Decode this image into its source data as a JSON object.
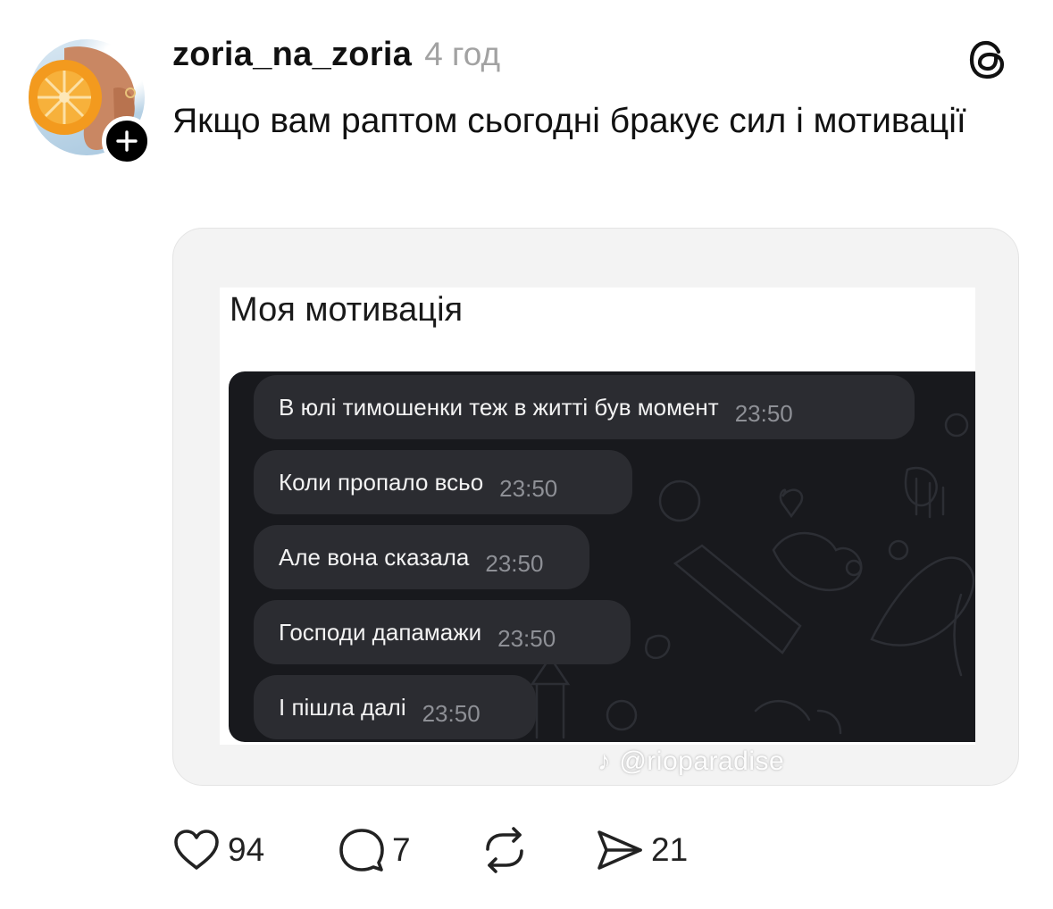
{
  "post": {
    "username": "zoria_na_zoria",
    "time": "4 год",
    "text": "Якщо вам раптом сьогодні бракує сил і мотивації"
  },
  "embedded_image": {
    "title": "Моя мотивація",
    "messages": [
      {
        "text": "В юлі тимошенки теж в житті був момент",
        "time": "23:50"
      },
      {
        "text": "Коли пропало всьо",
        "time": "23:50"
      },
      {
        "text": "Але вона сказала",
        "time": "23:50"
      },
      {
        "text": "Господи дапамажи",
        "time": "23:50"
      },
      {
        "text": "І пішла далі",
        "time": "23:50"
      }
    ],
    "watermark": "♪ @rioparadise"
  },
  "actions": {
    "likes": "94",
    "comments": "7",
    "shares": "21"
  },
  "icons": {
    "follow": "plus-icon",
    "app_logo": "threads-logo-icon",
    "like": "heart-icon",
    "comment": "comment-bubble-icon",
    "repost": "repost-icon",
    "share": "send-icon"
  },
  "colors": {
    "text": "#111111",
    "muted": "#a2a2a2",
    "chat_background": "#18191d",
    "bubble": "#2b2c31"
  }
}
